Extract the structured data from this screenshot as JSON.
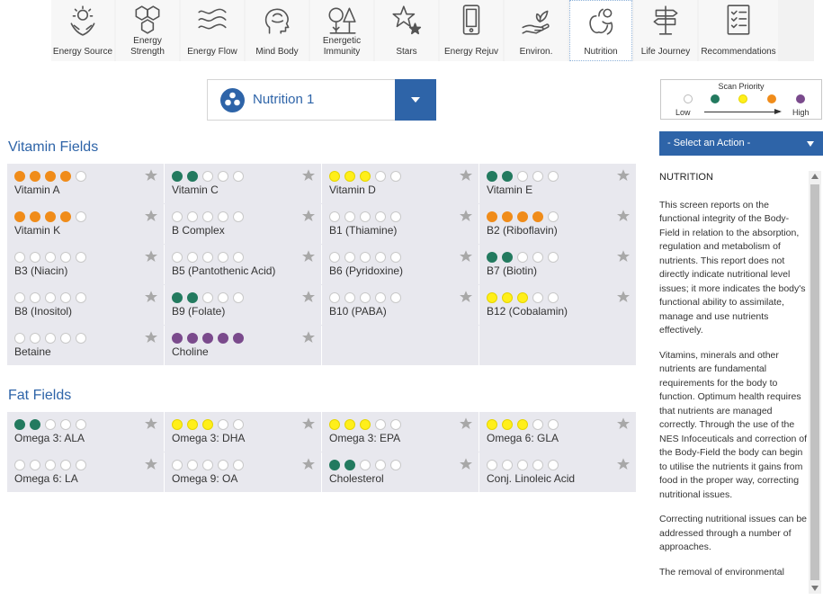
{
  "nav": [
    {
      "label": "Energy Source",
      "icon": "hands-sun-icon"
    },
    {
      "label": "Energy Strength",
      "icon": "hexagons-icon"
    },
    {
      "label": "Energy Flow",
      "icon": "waves-icon"
    },
    {
      "label": "Mind Body",
      "icon": "head-brain-icon"
    },
    {
      "label": "Energetic Immunity",
      "icon": "trees-icon"
    },
    {
      "label": "Stars",
      "icon": "stars-icon"
    },
    {
      "label": "Energy Rejuv",
      "icon": "phone-icon"
    },
    {
      "label": "Environ.",
      "icon": "hand-sprout-icon"
    },
    {
      "label": "Nutrition",
      "icon": "fruit-icon",
      "active": true
    },
    {
      "label": "Life Journey",
      "icon": "signpost-icon"
    },
    {
      "label": "Recommendations",
      "icon": "checklist-icon"
    }
  ],
  "selector": {
    "label": "Nutrition 1"
  },
  "legend": {
    "title": "Scan Priority",
    "low": "Low",
    "high": "High",
    "colors": [
      "#ffffff",
      "#237a5f",
      "#ffef1a",
      "#f08c1a",
      "#7a4a8c"
    ]
  },
  "action": {
    "label": "- Select an Action -"
  },
  "sections": {
    "vitamin": {
      "title": "Vitamin Fields"
    },
    "fat": {
      "title": "Fat Fields"
    }
  },
  "vitamin_fields": [
    {
      "name": "Vitamin A",
      "count": 4,
      "color": "orange"
    },
    {
      "name": "Vitamin C",
      "count": 2,
      "color": "green"
    },
    {
      "name": "Vitamin D",
      "count": 3,
      "color": "yellow"
    },
    {
      "name": "Vitamin E",
      "count": 2,
      "color": "green"
    },
    {
      "name": "Vitamin K",
      "count": 4,
      "color": "orange"
    },
    {
      "name": "B Complex",
      "count": 0,
      "color": "none"
    },
    {
      "name": "B1 (Thiamine)",
      "count": 0,
      "color": "none"
    },
    {
      "name": "B2 (Riboflavin)",
      "count": 4,
      "color": "orange"
    },
    {
      "name": "B3 (Niacin)",
      "count": 0,
      "color": "none"
    },
    {
      "name": "B5 (Pantothenic Acid)",
      "count": 0,
      "color": "none"
    },
    {
      "name": "B6 (Pyridoxine)",
      "count": 0,
      "color": "none"
    },
    {
      "name": "B7 (Biotin)",
      "count": 2,
      "color": "green"
    },
    {
      "name": "B8 (Inositol)",
      "count": 0,
      "color": "none"
    },
    {
      "name": "B9 (Folate)",
      "count": 2,
      "color": "green"
    },
    {
      "name": "B10 (PABA)",
      "count": 0,
      "color": "none"
    },
    {
      "name": "B12 (Cobalamin)",
      "count": 3,
      "color": "yellow"
    },
    {
      "name": "Betaine",
      "count": 0,
      "color": "none"
    },
    {
      "name": "Choline",
      "count": 5,
      "color": "purple"
    }
  ],
  "fat_fields": [
    {
      "name": "Omega 3: ALA",
      "count": 2,
      "color": "green"
    },
    {
      "name": "Omega 3: DHA",
      "count": 3,
      "color": "yellow"
    },
    {
      "name": "Omega 3: EPA",
      "count": 3,
      "color": "yellow"
    },
    {
      "name": "Omega 6: GLA",
      "count": 3,
      "color": "yellow"
    },
    {
      "name": "Omega 6: LA",
      "count": 0,
      "color": "none"
    },
    {
      "name": "Omega 9: OA",
      "count": 0,
      "color": "none"
    },
    {
      "name": "Cholesterol",
      "count": 2,
      "color": "green"
    },
    {
      "name": "Conj. Linoleic Acid",
      "count": 0,
      "color": "none"
    }
  ],
  "description": {
    "heading": "NUTRITION",
    "paragraphs": [
      "This screen reports on the functional integrity of the Body-Field in relation to the absorption, regulation and metabolism of nutrients. This report does not directly indicate nutritional level issues; it more indicates the body's functional ability to assimilate, manage and use nutrients effectively.",
      "Vitamins, minerals and other nutrients are fundamental requirements for the body to function. Optimum health requires that nutrients are managed correctly. Through the use of the NES Infoceuticals and correction of the Body-Field the body can begin to utilise the nutrients it gains from food in the proper way, correcting nutritional issues.",
      "Correcting nutritional issues can be addressed through a number of approaches.",
      "The removal of environmental"
    ]
  }
}
